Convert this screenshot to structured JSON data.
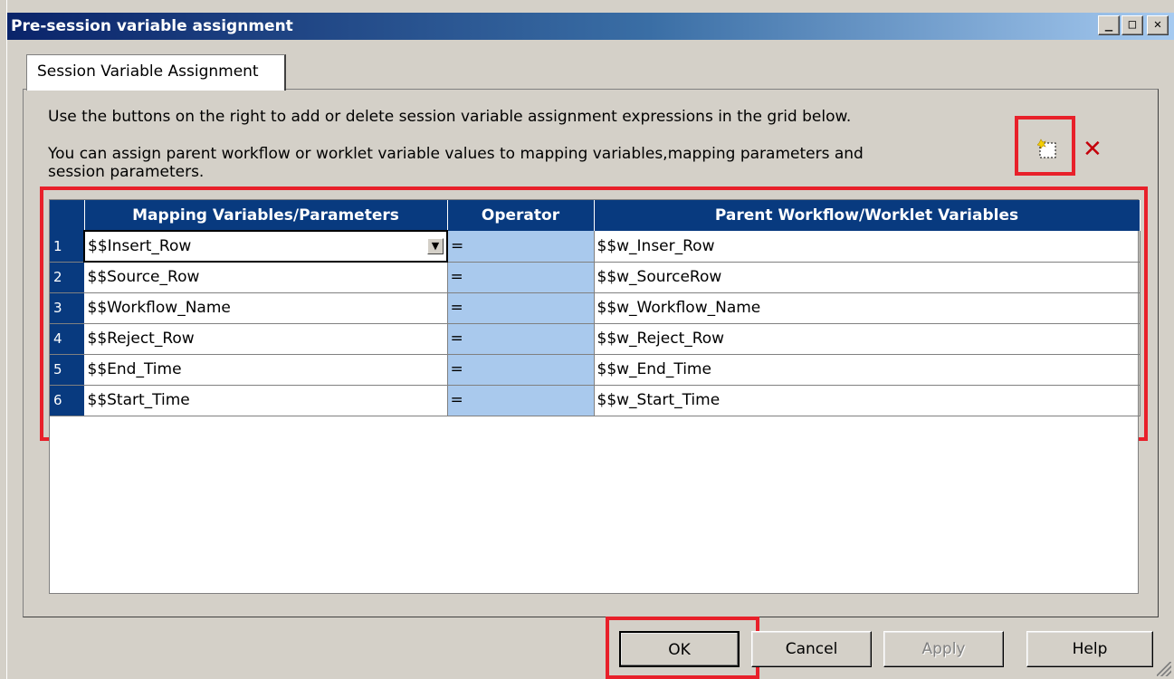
{
  "window": {
    "title": "Pre-session variable assignment",
    "minimize_label": "_",
    "maximize_label": "□",
    "close_label": "✕"
  },
  "tabs": [
    {
      "label": "Session Variable Assignment"
    }
  ],
  "instructions": {
    "line1": "Use the buttons on the right to add or delete session variable assignment expressions in the grid below.",
    "line2": "You can assign parent workflow or worklet variable values to mapping variables,mapping parameters and session parameters."
  },
  "toolbar": {
    "add_icon": "new-row-icon",
    "delete_icon": "delete-x-icon",
    "delete_symbol": "✕",
    "delete_color": "#c4000a"
  },
  "grid": {
    "columns": [
      "Mapping Variables/Parameters",
      "Operator",
      "Parent Workflow/Worklet Variables"
    ],
    "rows": [
      {
        "num": "1",
        "mapping": "$$Insert_Row",
        "op": "=",
        "parent": "$$w_Inser_Row"
      },
      {
        "num": "2",
        "mapping": "$$Source_Row",
        "op": "=",
        "parent": "$$w_SourceRow"
      },
      {
        "num": "3",
        "mapping": "$$Workflow_Name",
        "op": "=",
        "parent": "$$w_Workflow_Name"
      },
      {
        "num": "4",
        "mapping": "$$Reject_Row",
        "op": "=",
        "parent": "$$w_Reject_Row"
      },
      {
        "num": "5",
        "mapping": "$$End_Time",
        "op": "=",
        "parent": "$$w_End_Time"
      },
      {
        "num": "6",
        "mapping": "$$Start_Time",
        "op": "=",
        "parent": "$$w_Start_Time"
      }
    ],
    "header_color": "#083a7f",
    "operator_color": "#a9c9ed"
  },
  "buttons": {
    "ok": "OK",
    "cancel": "Cancel",
    "apply": "Apply",
    "help": "Help"
  },
  "highlight_color": "#e8202a"
}
